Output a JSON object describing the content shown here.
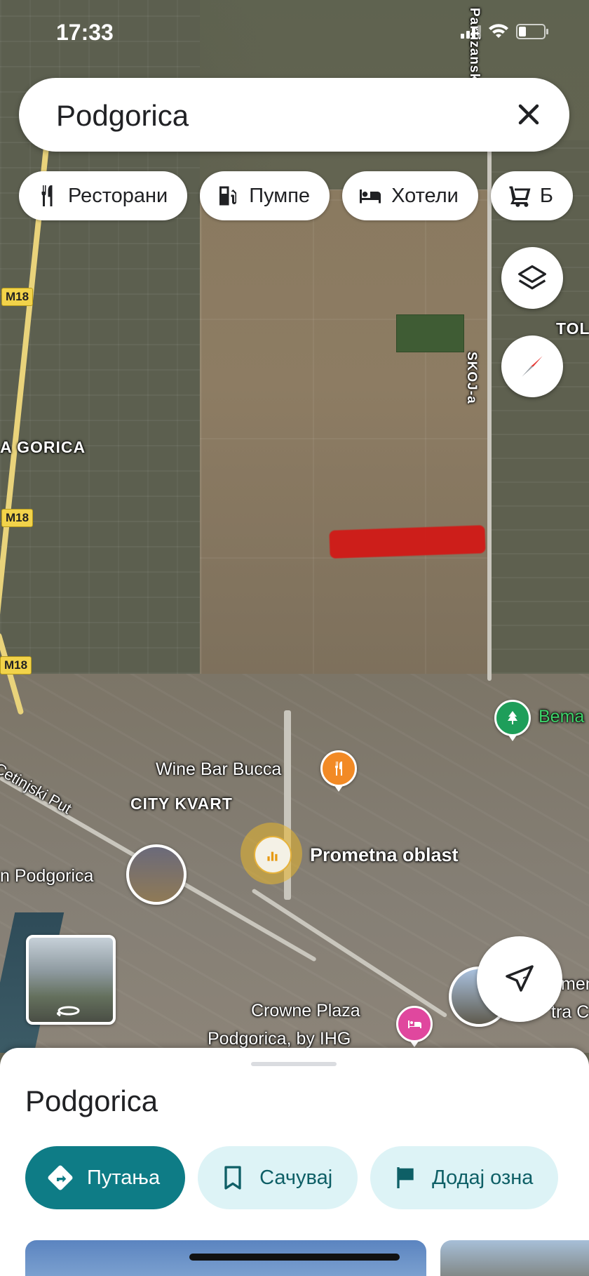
{
  "status_bar": {
    "time": "17:33"
  },
  "search": {
    "query": "Podgorica"
  },
  "chips": [
    {
      "label": "Ресторани",
      "icon": "restaurant-icon"
    },
    {
      "label": "Пумпе",
      "icon": "gas-station-icon"
    },
    {
      "label": "Хотели",
      "icon": "hotel-icon"
    },
    {
      "label": "Б",
      "icon": "shopping-cart-icon"
    }
  ],
  "map": {
    "road_labels": [
      "M18",
      "M18",
      "M18"
    ],
    "labels": {
      "skoja": "SKOJ-a",
      "partizanski": "Partizanski",
      "tol": "TOL",
      "gorica": "A GORICA",
      "wine_bar": "Wine Bar Bucca",
      "city_kvart": "CITY KVART",
      "cetinjski": "Cetinjski Put",
      "prometna": "Prometna oblast",
      "podgorica_left": "n Podgorica",
      "crowne_line1": "Crowne Plaza",
      "crowne_line2": "Podgorica, by IHG",
      "bema": "Bema",
      "right_cut_1": "men",
      "right_cut_2": "tra C"
    }
  },
  "sheet": {
    "title": "Podgorica",
    "actions": [
      {
        "label": "Путања",
        "icon": "directions-icon"
      },
      {
        "label": "Сачувај",
        "icon": "bookmark-icon"
      },
      {
        "label": "Додај озна",
        "icon": "flag-icon"
      }
    ]
  },
  "colors": {
    "primary": "#0e7c86",
    "secondary_bg": "#ddf3f6",
    "highlight": "#d11a17"
  }
}
